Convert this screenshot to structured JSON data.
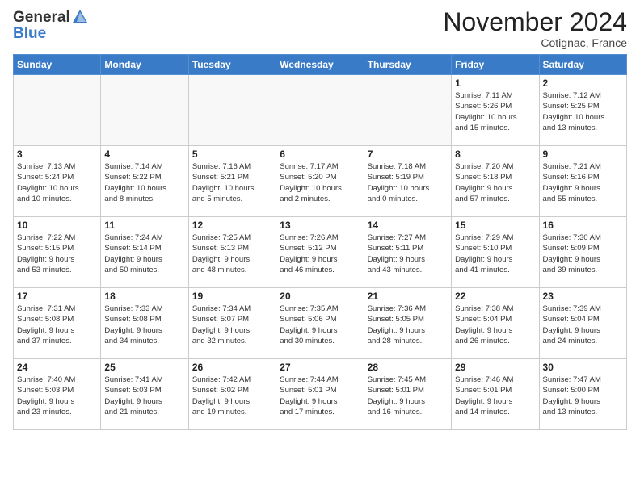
{
  "header": {
    "logo_general": "General",
    "logo_blue": "Blue",
    "month": "November 2024",
    "location": "Cotignac, France"
  },
  "weekdays": [
    "Sunday",
    "Monday",
    "Tuesday",
    "Wednesday",
    "Thursday",
    "Friday",
    "Saturday"
  ],
  "weeks": [
    [
      {
        "day": "",
        "info": ""
      },
      {
        "day": "",
        "info": ""
      },
      {
        "day": "",
        "info": ""
      },
      {
        "day": "",
        "info": ""
      },
      {
        "day": "",
        "info": ""
      },
      {
        "day": "1",
        "info": "Sunrise: 7:11 AM\nSunset: 5:26 PM\nDaylight: 10 hours\nand 15 minutes."
      },
      {
        "day": "2",
        "info": "Sunrise: 7:12 AM\nSunset: 5:25 PM\nDaylight: 10 hours\nand 13 minutes."
      }
    ],
    [
      {
        "day": "3",
        "info": "Sunrise: 7:13 AM\nSunset: 5:24 PM\nDaylight: 10 hours\nand 10 minutes."
      },
      {
        "day": "4",
        "info": "Sunrise: 7:14 AM\nSunset: 5:22 PM\nDaylight: 10 hours\nand 8 minutes."
      },
      {
        "day": "5",
        "info": "Sunrise: 7:16 AM\nSunset: 5:21 PM\nDaylight: 10 hours\nand 5 minutes."
      },
      {
        "day": "6",
        "info": "Sunrise: 7:17 AM\nSunset: 5:20 PM\nDaylight: 10 hours\nand 2 minutes."
      },
      {
        "day": "7",
        "info": "Sunrise: 7:18 AM\nSunset: 5:19 PM\nDaylight: 10 hours\nand 0 minutes."
      },
      {
        "day": "8",
        "info": "Sunrise: 7:20 AM\nSunset: 5:18 PM\nDaylight: 9 hours\nand 57 minutes."
      },
      {
        "day": "9",
        "info": "Sunrise: 7:21 AM\nSunset: 5:16 PM\nDaylight: 9 hours\nand 55 minutes."
      }
    ],
    [
      {
        "day": "10",
        "info": "Sunrise: 7:22 AM\nSunset: 5:15 PM\nDaylight: 9 hours\nand 53 minutes."
      },
      {
        "day": "11",
        "info": "Sunrise: 7:24 AM\nSunset: 5:14 PM\nDaylight: 9 hours\nand 50 minutes."
      },
      {
        "day": "12",
        "info": "Sunrise: 7:25 AM\nSunset: 5:13 PM\nDaylight: 9 hours\nand 48 minutes."
      },
      {
        "day": "13",
        "info": "Sunrise: 7:26 AM\nSunset: 5:12 PM\nDaylight: 9 hours\nand 46 minutes."
      },
      {
        "day": "14",
        "info": "Sunrise: 7:27 AM\nSunset: 5:11 PM\nDaylight: 9 hours\nand 43 minutes."
      },
      {
        "day": "15",
        "info": "Sunrise: 7:29 AM\nSunset: 5:10 PM\nDaylight: 9 hours\nand 41 minutes."
      },
      {
        "day": "16",
        "info": "Sunrise: 7:30 AM\nSunset: 5:09 PM\nDaylight: 9 hours\nand 39 minutes."
      }
    ],
    [
      {
        "day": "17",
        "info": "Sunrise: 7:31 AM\nSunset: 5:08 PM\nDaylight: 9 hours\nand 37 minutes."
      },
      {
        "day": "18",
        "info": "Sunrise: 7:33 AM\nSunset: 5:08 PM\nDaylight: 9 hours\nand 34 minutes."
      },
      {
        "day": "19",
        "info": "Sunrise: 7:34 AM\nSunset: 5:07 PM\nDaylight: 9 hours\nand 32 minutes."
      },
      {
        "day": "20",
        "info": "Sunrise: 7:35 AM\nSunset: 5:06 PM\nDaylight: 9 hours\nand 30 minutes."
      },
      {
        "day": "21",
        "info": "Sunrise: 7:36 AM\nSunset: 5:05 PM\nDaylight: 9 hours\nand 28 minutes."
      },
      {
        "day": "22",
        "info": "Sunrise: 7:38 AM\nSunset: 5:04 PM\nDaylight: 9 hours\nand 26 minutes."
      },
      {
        "day": "23",
        "info": "Sunrise: 7:39 AM\nSunset: 5:04 PM\nDaylight: 9 hours\nand 24 minutes."
      }
    ],
    [
      {
        "day": "24",
        "info": "Sunrise: 7:40 AM\nSunset: 5:03 PM\nDaylight: 9 hours\nand 23 minutes."
      },
      {
        "day": "25",
        "info": "Sunrise: 7:41 AM\nSunset: 5:03 PM\nDaylight: 9 hours\nand 21 minutes."
      },
      {
        "day": "26",
        "info": "Sunrise: 7:42 AM\nSunset: 5:02 PM\nDaylight: 9 hours\nand 19 minutes."
      },
      {
        "day": "27",
        "info": "Sunrise: 7:44 AM\nSunset: 5:01 PM\nDaylight: 9 hours\nand 17 minutes."
      },
      {
        "day": "28",
        "info": "Sunrise: 7:45 AM\nSunset: 5:01 PM\nDaylight: 9 hours\nand 16 minutes."
      },
      {
        "day": "29",
        "info": "Sunrise: 7:46 AM\nSunset: 5:01 PM\nDaylight: 9 hours\nand 14 minutes."
      },
      {
        "day": "30",
        "info": "Sunrise: 7:47 AM\nSunset: 5:00 PM\nDaylight: 9 hours\nand 13 minutes."
      }
    ]
  ]
}
